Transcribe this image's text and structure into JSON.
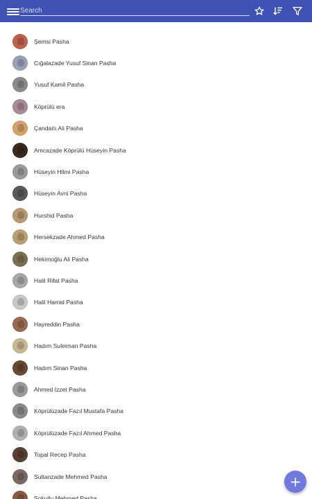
{
  "appbar": {
    "color": "#3f51b5",
    "menu_icon": "menu-icon",
    "search_placeholder": "Search",
    "search_value": "",
    "actions": [
      {
        "icon": "star-icon"
      },
      {
        "icon": "sort-icon"
      },
      {
        "icon": "filter-icon"
      }
    ]
  },
  "items": [
    {
      "label": "Şemsi Pasha",
      "avatar_color": "#c0604a"
    },
    {
      "label": "Cığalazade Yusuf Sinan Pasha",
      "avatar_color": "#9aa3b5"
    },
    {
      "label": "Yusuf Kamil Pasha",
      "avatar_color": "#8a8a8a"
    },
    {
      "label": "Köprülü era",
      "avatar_color": "#a98a9a"
    },
    {
      "label": "Çandarlı Ali Pasha",
      "avatar_color": "#d6a06a"
    },
    {
      "label": "Amcazade Köprülü Hüseyin Pasha",
      "avatar_color": "#3a2a1e"
    },
    {
      "label": "Hüseyin Hilmi Pasha",
      "avatar_color": "#9a9a9a"
    },
    {
      "label": "Hüseyin Avni Pasha",
      "avatar_color": "#5a5a5a"
    },
    {
      "label": "Hurshid Pasha",
      "avatar_color": "#b89a70"
    },
    {
      "label": "Hersekzade Ahmed Pasha",
      "avatar_color": "#b8a070"
    },
    {
      "label": "Hekimoğlu Ali Pasha",
      "avatar_color": "#7a7050"
    },
    {
      "label": "Halil Rifat Pasha",
      "avatar_color": "#a8a8a8"
    },
    {
      "label": "Halil Hamid Pasha",
      "avatar_color": "#c8c8c8"
    },
    {
      "label": "Hayreddin Pasha",
      "avatar_color": "#9a6a50"
    },
    {
      "label": "Hadım Suleiman Pasha",
      "avatar_color": "#c8b890"
    },
    {
      "label": "Hadım Sinan Pasha",
      "avatar_color": "#6a4a30"
    },
    {
      "label": "Ahmed Izzet Pasha",
      "avatar_color": "#9a9a9a"
    },
    {
      "label": "Köprülüzade Fazıl Mustafa Pasha",
      "avatar_color": "#8a8a8a"
    },
    {
      "label": "Köprülüzade Fazıl Ahmed Pasha",
      "avatar_color": "#b0b0b0"
    },
    {
      "label": "Topal Recep Pasha",
      "avatar_color": "#5a4030"
    },
    {
      "label": "Sultanzade Mehmed Pasha",
      "avatar_color": "#7a6a60"
    },
    {
      "label": "Sokullu Mehmed Pasha",
      "avatar_color": "#8a5a40"
    }
  ],
  "fab": {
    "icon": "plus-icon",
    "symbol": "+",
    "color": "#7079e0"
  }
}
